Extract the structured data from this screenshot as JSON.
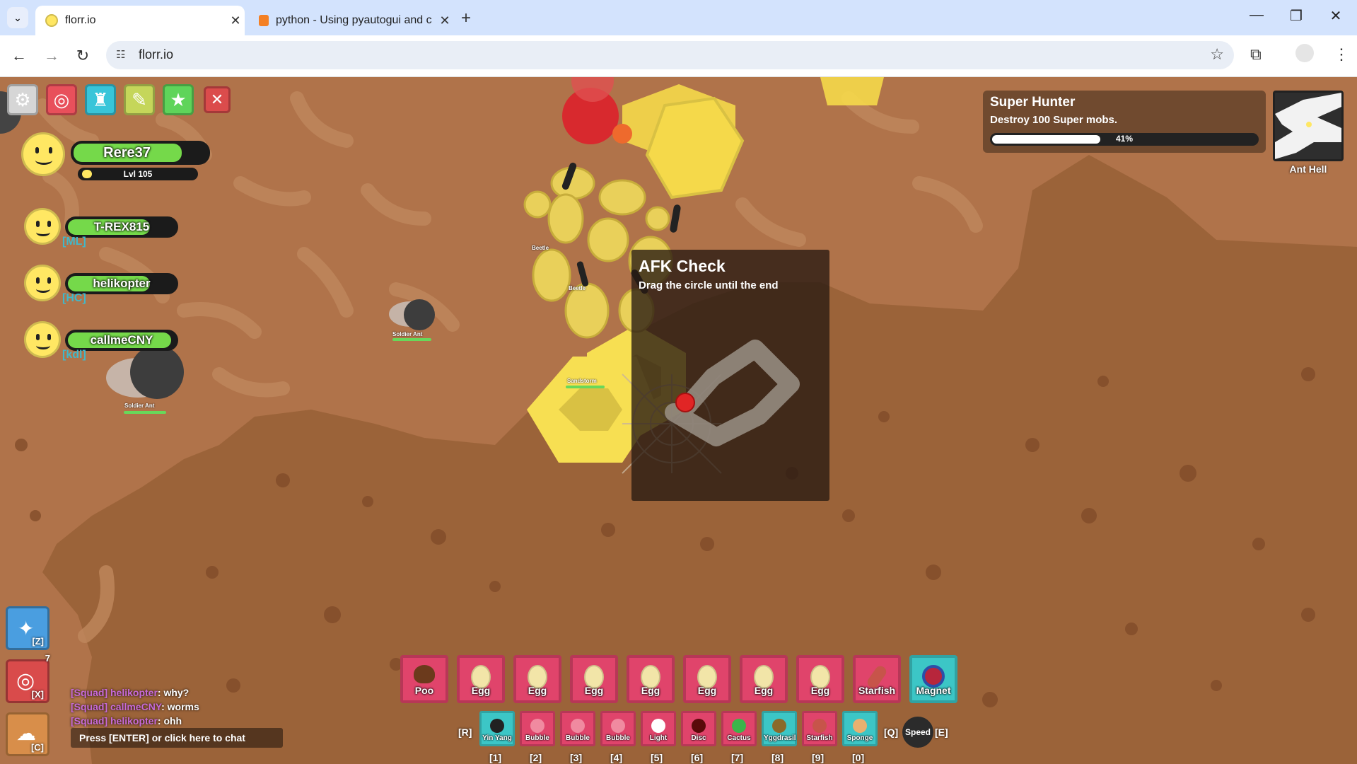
{
  "browser": {
    "tabs": [
      {
        "title": "florr.io",
        "active": true
      },
      {
        "title": "python - Using pyautogui and c",
        "active": false
      }
    ],
    "address": "florr.io",
    "icons": [
      "tab-dropdown-icon",
      "new-tab-icon",
      "minimize-icon",
      "restore-icon",
      "close-window-icon",
      "back-icon",
      "forward-icon",
      "reload-icon",
      "site-info-icon",
      "bookmark-star-icon",
      "extensions-icon",
      "profile-icon",
      "menu-dots-icon"
    ]
  },
  "toolbar": {
    "buttons": [
      "settings-icon",
      "crafting-icon",
      "inventory-icon",
      "changelog-icon",
      "favorite-icon",
      "close-icon"
    ],
    "colors": [
      "#d6d6d6",
      "#e8505b",
      "#38c5d9",
      "#c5d65a",
      "#5fd45a",
      "#db4c4c"
    ]
  },
  "squad": {
    "me": {
      "name": "Rere37",
      "level": "Lvl 105"
    },
    "members": [
      {
        "name": "T-REX815",
        "tag": "[ML]"
      },
      {
        "name": "helikopter",
        "tag": "[HC]"
      },
      {
        "name": "callmeCNY",
        "tag": "[kdl]"
      }
    ]
  },
  "quest": {
    "title": "Super Hunter",
    "description": "Destroy 100 Super mobs.",
    "progress_label": "41%",
    "progress": 0.41
  },
  "minimap": {
    "label": "Ant Hell"
  },
  "afk": {
    "title": "AFK Check",
    "subtitle": "Drag the circle until the end"
  },
  "mob_labels": {
    "soldier_ant": "Soldier Ant",
    "beetle": "Beetle",
    "sandstorm": "Sandstorm"
  },
  "side_buttons": [
    {
      "key": "[Z]",
      "color": "#4a9ee0"
    },
    {
      "key": "[X]",
      "color": "#d94b4b",
      "badge": "7"
    },
    {
      "key": "[C]",
      "color": "#d88e4a"
    }
  ],
  "chat": {
    "messages": [
      {
        "prefix": "[Squad] helikopter",
        "text": ": why?"
      },
      {
        "prefix": "[Squad] callmeCNY",
        "text": ": worms"
      },
      {
        "prefix": "[Squad] helikopter",
        "text": ": ohh"
      }
    ],
    "input_hint": "Press [ENTER] or click here to chat"
  },
  "hotbar": {
    "primary": [
      {
        "label": "Poo",
        "rarity": "#e0446b"
      },
      {
        "label": "Egg",
        "rarity": "#e0446b"
      },
      {
        "label": "Egg",
        "rarity": "#e0446b"
      },
      {
        "label": "Egg",
        "rarity": "#e0446b"
      },
      {
        "label": "Egg",
        "rarity": "#e0446b"
      },
      {
        "label": "Egg",
        "rarity": "#e0446b"
      },
      {
        "label": "Egg",
        "rarity": "#e0446b"
      },
      {
        "label": "Egg",
        "rarity": "#e0446b"
      },
      {
        "label": "Starfish",
        "rarity": "#e0446b"
      },
      {
        "label": "Magnet",
        "rarity": "#3cc6c6"
      }
    ],
    "secondary": [
      {
        "label": "Yin Yang",
        "rarity": "#3cc6c6",
        "key": "[1]"
      },
      {
        "label": "Bubble",
        "rarity": "#e0446b",
        "key": "[2]"
      },
      {
        "label": "Bubble",
        "rarity": "#e0446b",
        "key": "[3]"
      },
      {
        "label": "Bubble",
        "rarity": "#e0446b",
        "key": "[4]"
      },
      {
        "label": "Light",
        "rarity": "#e0446b",
        "key": "[5]"
      },
      {
        "label": "Disc",
        "rarity": "#e0446b",
        "key": "[6]"
      },
      {
        "label": "Cactus",
        "rarity": "#e0446b",
        "key": "[7]"
      },
      {
        "label": "Yggdrasil",
        "rarity": "#3cc6c6",
        "key": "[8]"
      },
      {
        "label": "Starfish",
        "rarity": "#e0446b",
        "key": "[9]"
      },
      {
        "label": "Sponge",
        "rarity": "#3cc6c6",
        "key": "[0]"
      }
    ],
    "key_left": "[R]",
    "key_q": "[Q]",
    "speed_label": "Speed",
    "key_e": "[E]"
  }
}
